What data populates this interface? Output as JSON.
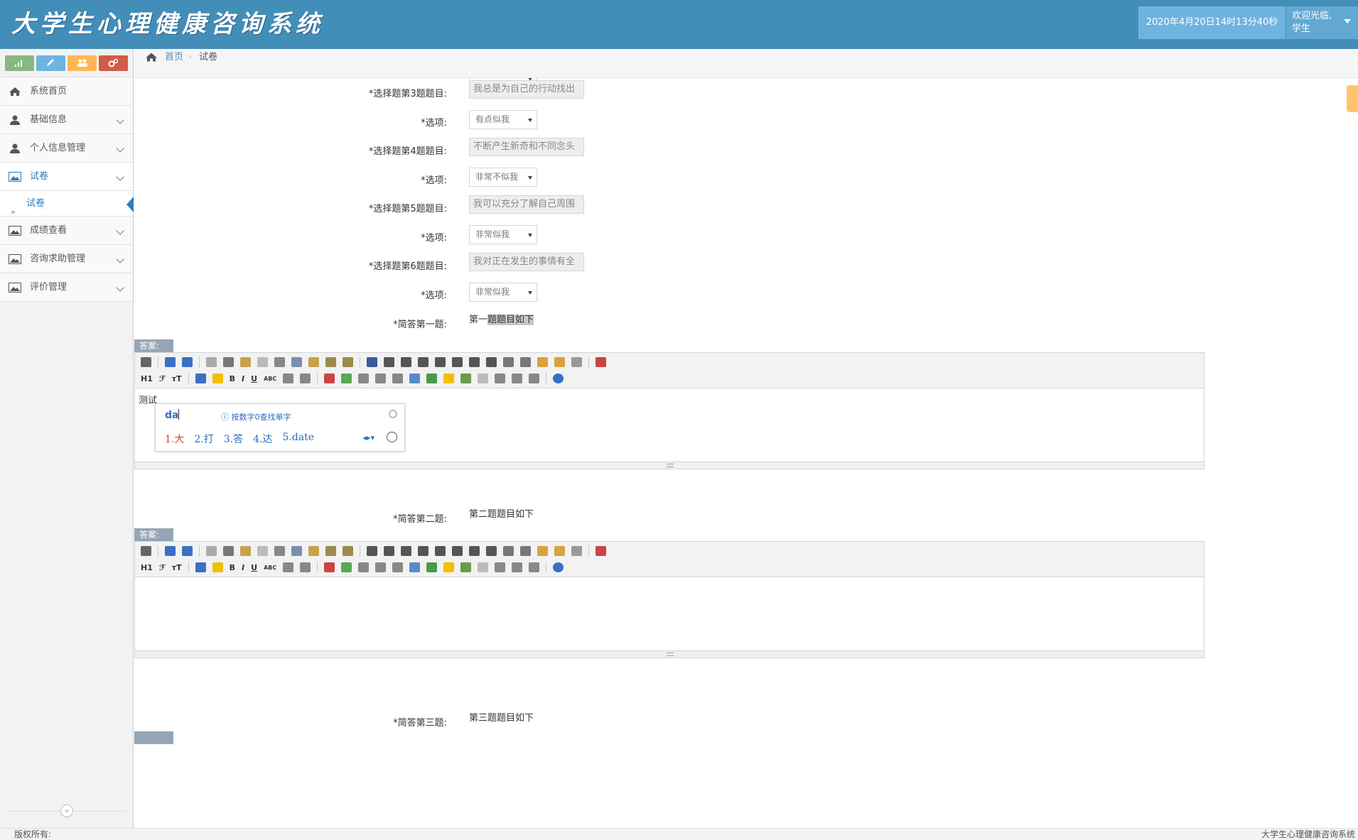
{
  "header": {
    "title": "大学生心理健康咨询系统",
    "datetime": "2020年4月20日14时13分40秒",
    "welcome_line1": "欢迎光临,",
    "welcome_line2": "学生"
  },
  "sidebar": {
    "items": [
      {
        "label": "系统首页",
        "icon": "home-icon"
      },
      {
        "label": "基础信息",
        "icon": "user-icon"
      },
      {
        "label": "个人信息管理",
        "icon": "user-icon"
      },
      {
        "label": "试卷",
        "icon": "picture-icon"
      },
      {
        "label": "成绩查看",
        "icon": "picture-icon"
      },
      {
        "label": "咨询求助管理",
        "icon": "picture-icon"
      },
      {
        "label": "评价管理",
        "icon": "picture-icon"
      }
    ],
    "sub_item": "试卷",
    "collapse": "«"
  },
  "breadcrumb": {
    "home": "首页",
    "current": "试卷"
  },
  "form": {
    "q3_label": "*选择题第3题题目:",
    "q3_value": "我总是为自己的行动找出",
    "q3_opt_label": "*选项:",
    "q3_opt": "有点似我",
    "q4_label": "*选择题第4题题目:",
    "q4_value": "不断产生新奇和不同念头",
    "q4_opt_label": "*选项:",
    "q4_opt": "非常不似我",
    "q5_label": "*选择题第5题题目:",
    "q5_value": "我可以充分了解自己周围",
    "q5_opt_label": "*选项:",
    "q5_opt": "非常似我",
    "q6_label": "*选择题第6题题目:",
    "q6_value": "我对正在发生的事情有全",
    "q6_opt_label": "*选项:",
    "q6_opt": "非常似我",
    "s1_label": "*简答第一题:",
    "s1_text_a": "第一",
    "s1_text_b": "题题目如下",
    "answer_tag": "答案:",
    "s1_answer": "测试",
    "s2_label": "*简答第二题:",
    "s2_text": "第二题题目如下",
    "s3_label": "*简答第三题:",
    "s3_text": "第三题题目如下"
  },
  "toolbar": {
    "h1": "H1",
    "font": "ℱ",
    "size": "ᴛT",
    "bold": "B",
    "italic": "I",
    "underline": "U",
    "abc": "ABC"
  },
  "ime": {
    "pinyin": "da",
    "hint": "按数字0查找单字",
    "c1": "1.大",
    "c2": "2.打",
    "c3": "3.答",
    "c4": "4.达",
    "c5": "5.date"
  },
  "footer": {
    "left": "版权所有:",
    "right": "大学生心理健康咨询系统"
  },
  "colors": {
    "header": "#438eb9",
    "accent": "#2b7dbc"
  }
}
